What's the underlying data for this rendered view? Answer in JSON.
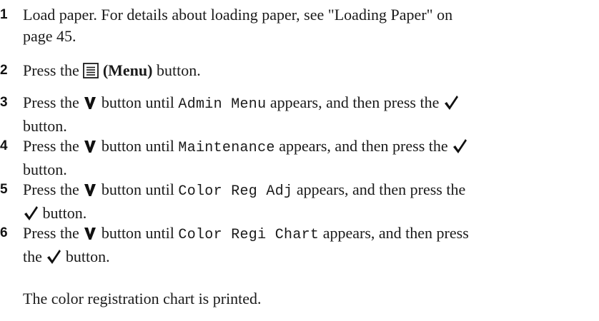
{
  "steps": [
    {
      "number": "1",
      "text": "Load paper. For details about loading paper, see \"Loading Paper\" on",
      "text_cont": "page 45."
    },
    {
      "number": "2",
      "pre": "Press the",
      "menu_label": "(Menu)",
      "post": "button."
    },
    {
      "number": "3",
      "pre": "Press the",
      "mid": "button until",
      "item": "Admin Menu",
      "post": "appears, and then press the",
      "end": "button."
    },
    {
      "number": "4",
      "pre": "Press the",
      "mid": "button until",
      "item": "Maintenance",
      "post": "appears, and then press the",
      "end": "button."
    },
    {
      "number": "5",
      "pre": "Press the",
      "mid": "button until",
      "item": "Color Reg Adj",
      "post": "appears, and then press the",
      "end": "button."
    },
    {
      "number": "6",
      "pre": "Press the",
      "mid": "button until",
      "item": "Color Regi Chart",
      "post": "appears, and then press",
      "end_pre": "the",
      "end": "button."
    }
  ],
  "result_note": "The color registration chart is printed.",
  "icons": {
    "menu": "menu-icon",
    "down": "down-arrow-icon",
    "ok": "checkmark-icon"
  }
}
